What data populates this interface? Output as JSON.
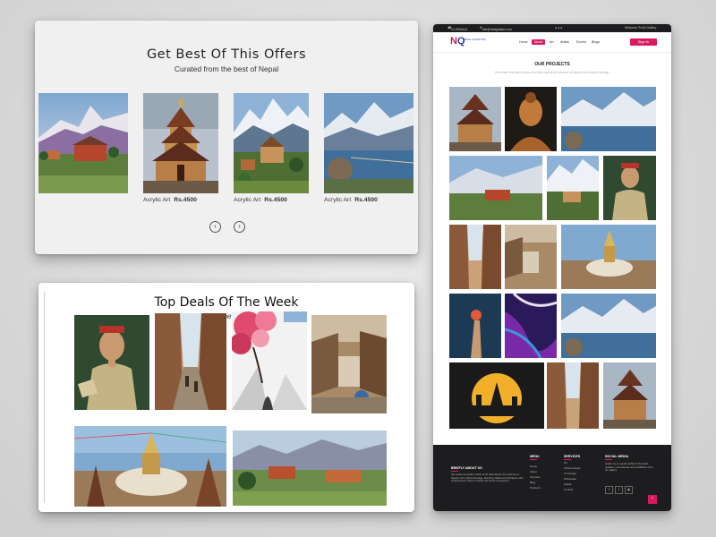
{
  "offers": {
    "title": "Get Best Of This Offers",
    "subtitle": "Curated from the best of Nepal",
    "items": [
      {
        "category": "Acrylic Art",
        "price": "Rs.4500"
      },
      {
        "category": "Acrylic Art",
        "price": "Rs.4500"
      },
      {
        "category": "Acrylic Art",
        "price": "Rs.4500"
      }
    ],
    "prev_icon": "chevron-left-icon",
    "next_icon": "chevron-right-icon"
  },
  "deals": {
    "title": "Top Deals Of The Week",
    "subtitle": "Curated from the best of Nepal"
  },
  "site": {
    "topbar": {
      "phone": "01-5906442",
      "email": "info@nbdigitalart.com",
      "welcome": "Welcome To Art Gallery"
    },
    "logo": "NQ",
    "logo_tagline": "NEPAL QUANTUM",
    "nav": [
      "Home",
      "About",
      "Art",
      "Artists",
      "Events",
      "Blogs"
    ],
    "nav_active_index": 1,
    "signin": "Sign In",
    "projects_title": "OUR PROJECTS",
    "projects_subtitle": "We create innovative works of art that capture the essence of Nepal's rich cultural heritage.",
    "footer": {
      "about_head": "BRIEFLY ABOUT US",
      "about_text": "We create innovative works of art that capture the essence of Nepal's rich cultural heritage, blending traditional techniques with contemporary vision to inspire art lovers everywhere.",
      "menu_head": "MENU",
      "menu_items": [
        "Home",
        "About",
        "Services",
        "Blog",
        "Products"
      ],
      "services_head": "SERVICES",
      "services_items": [
        "Art",
        "Online Design",
        "Art Design",
        "Wholesale",
        "Digital",
        "Contact"
      ],
      "social_head": "SOCIAL MEDIA",
      "social_text": "Follow us on social media for the latest updates, new artworks and exhibitions from our gallery.",
      "social_icons": [
        "twitter-icon",
        "facebook-icon",
        "instagram-icon"
      ]
    }
  }
}
